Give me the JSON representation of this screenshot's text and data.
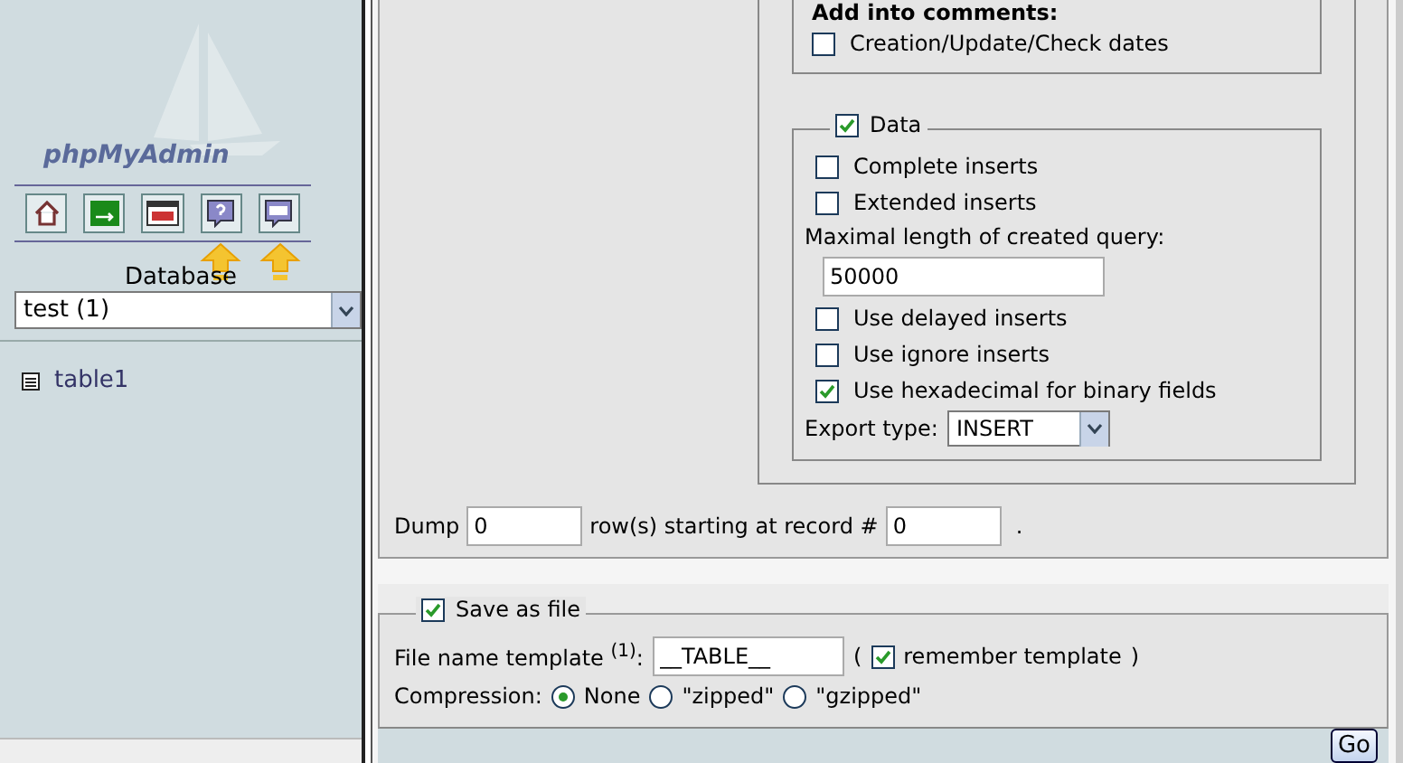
{
  "sidebar": {
    "logo": "phpMyAdmin",
    "database_label": "Database",
    "database_select": "test (1)",
    "tables": [
      {
        "name": "table1"
      }
    ]
  },
  "export_options": {
    "comments_heading": "Add into comments:",
    "comment_options": [
      {
        "label": "Creation/Update/Check dates",
        "checked": false
      }
    ],
    "data": {
      "label": "Data",
      "checked": true,
      "options": [
        {
          "kind": "checkbox",
          "label": "Complete inserts",
          "checked": false
        },
        {
          "kind": "checkbox",
          "label": "Extended inserts",
          "checked": false
        },
        {
          "kind": "field",
          "label": "Maximal length of created query:",
          "value": "50000"
        },
        {
          "kind": "checkbox",
          "label": "Use delayed inserts",
          "checked": false
        },
        {
          "kind": "checkbox",
          "label": "Use ignore inserts",
          "checked": false
        },
        {
          "kind": "checkbox",
          "label": "Use hexadecimal for binary fields",
          "checked": true
        },
        {
          "kind": "select",
          "label": "Export type:",
          "value": "INSERT"
        }
      ]
    }
  },
  "dump": {
    "label": "Dump",
    "rows": "0",
    "middle": "row(s) starting at record #",
    "start": "0",
    "end": "."
  },
  "save_file": {
    "label": "Save as file",
    "checked": true,
    "template_label": "File name template $^{(1)}$:",
    "template_value": "__TABLE__",
    "open_paren": "(",
    "remember_label": "remember template",
    "remember_checked": true,
    "close_paren": ")",
    "compression_label": "Compression:",
    "compression": [
      {
        "label": "None",
        "selected": true
      },
      {
        "label": "\"zipped\"",
        "selected": false
      },
      {
        "label": "\"gzipped\"",
        "selected": false
      }
    ]
  },
  "go_button": "Go"
}
